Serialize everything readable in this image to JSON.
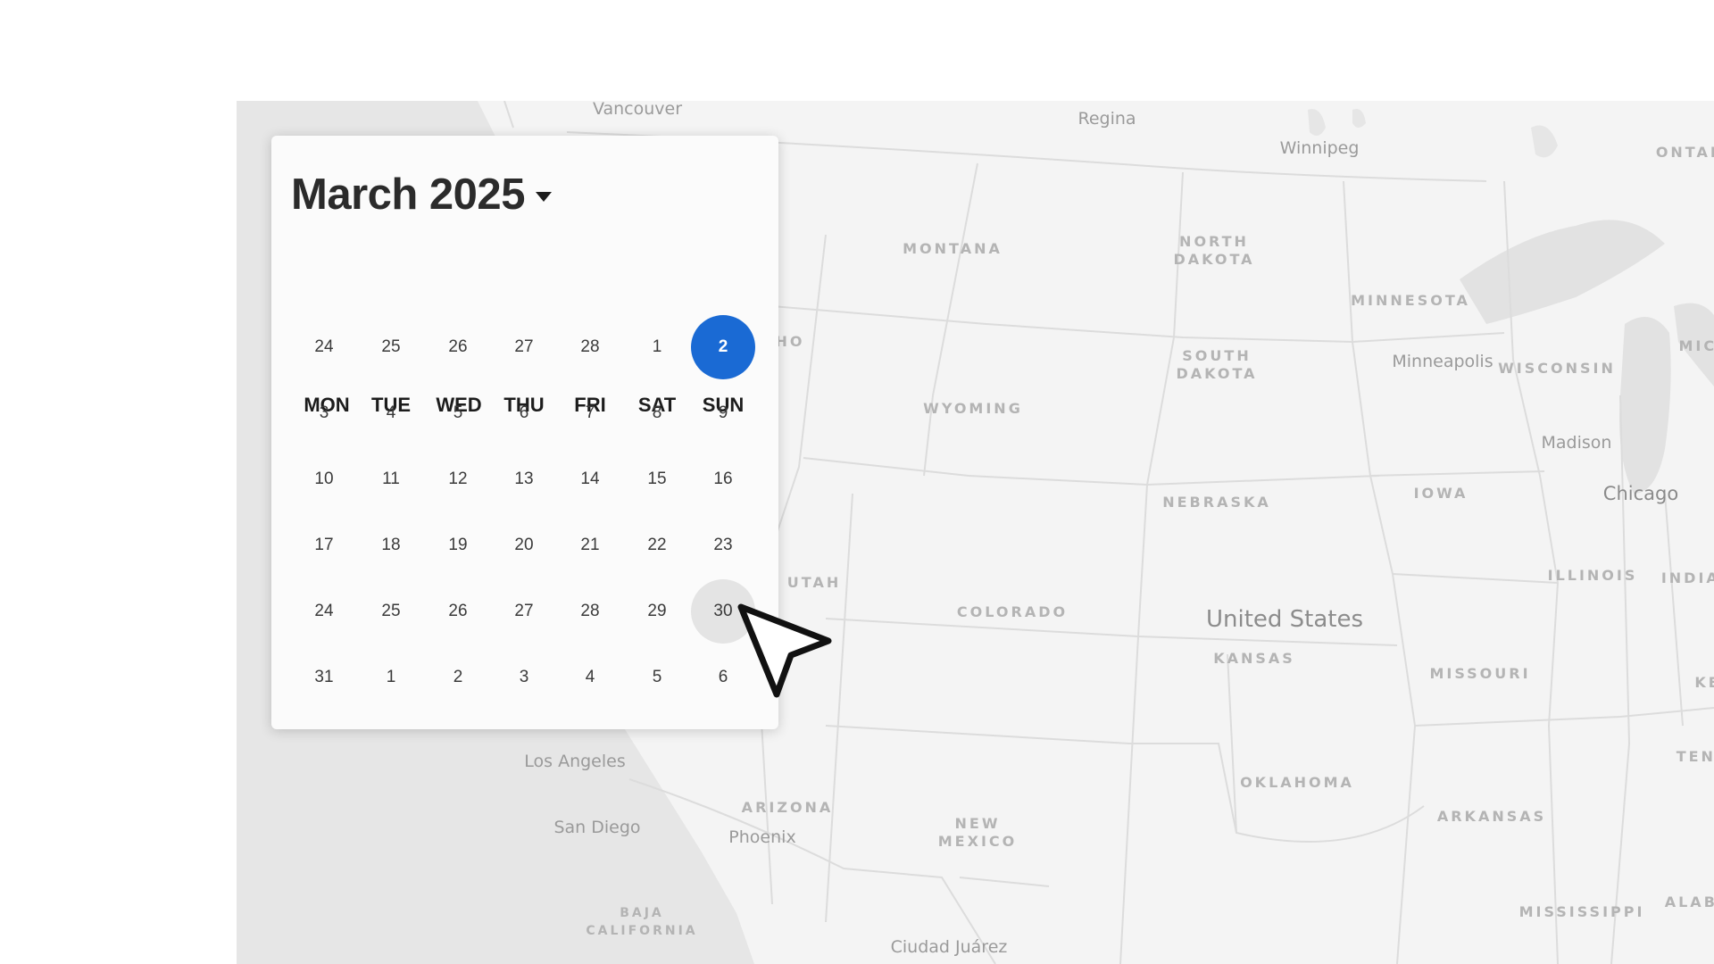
{
  "calendar": {
    "month_label": "March 2025",
    "caret_icon": "caret-down-icon",
    "weekdays": [
      "MON",
      "TUE",
      "WED",
      "THU",
      "FRI",
      "SAT",
      "SUN"
    ],
    "weeks": [
      [
        "24",
        "25",
        "26",
        "27",
        "28",
        "1",
        "2"
      ],
      [
        "3",
        "4",
        "5",
        "6",
        "7",
        "8",
        "9"
      ],
      [
        "10",
        "11",
        "12",
        "13",
        "14",
        "15",
        "16"
      ],
      [
        "17",
        "18",
        "19",
        "20",
        "21",
        "22",
        "23"
      ],
      [
        "24",
        "25",
        "26",
        "27",
        "28",
        "29",
        "30"
      ],
      [
        "31",
        "1",
        "2",
        "3",
        "4",
        "5",
        "6"
      ]
    ],
    "selected_day": "2",
    "hovered_day": "30",
    "selected_color": "#1a6ad4",
    "hover_color": "#e4e4e4"
  },
  "map": {
    "country_label": "United States",
    "cities": {
      "vancouver": "Vancouver",
      "regina": "Regina",
      "winnipeg": "Winnipeg",
      "minneapolis": "Minneapolis",
      "madison": "Madison",
      "chicago": "Chicago",
      "los_angeles": "Los Angeles",
      "san_diego": "San Diego",
      "phoenix": "Phoenix",
      "ciudad_juarez": "Ciudad Juárez"
    },
    "regions": {
      "ontario": "ONTAR",
      "montana": "MONTANA",
      "north_dakota": "NORTH\nDAKOTA",
      "south_dakota": "SOUTH\nDAKOTA",
      "minnesota": "MINNESOTA",
      "wisconsin": "WISCONSIN",
      "michigan": "MICH",
      "idaho": "HO",
      "wyoming": "WYOMING",
      "nebraska": "NEBRASKA",
      "iowa": "IOWA",
      "illinois": "ILLINOIS",
      "indiana": "INDIAN",
      "utah": "UTAH",
      "colorado": "COLORADO",
      "kansas": "KANSAS",
      "missouri": "MISSOURI",
      "kentucky": "KE",
      "tennessee": "TENN",
      "oklahoma": "OKLAHOMA",
      "arkansas": "ARKANSAS",
      "arizona": "ARIZONA",
      "new_mexico": "NEW\nMEXICO",
      "mississippi": "MISSISSIPPI",
      "alabama": "ALABA",
      "baja_california": "BAJA\nCALIFORNIA"
    }
  },
  "cursor": {
    "icon": "mouse-pointer-icon"
  }
}
